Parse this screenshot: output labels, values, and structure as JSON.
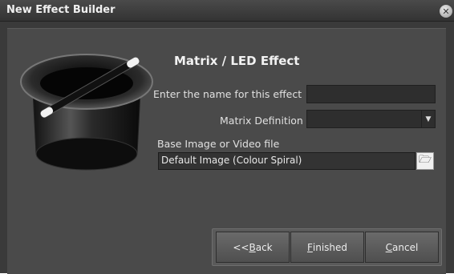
{
  "window": {
    "title": "New Effect Builder",
    "close_glyph": "✕"
  },
  "main": {
    "heading": "Matrix / LED Effect",
    "name_label": "Enter the name for this effect",
    "name_value": "",
    "matrix_label": "Matrix Definition",
    "matrix_value": "",
    "matrix_arrow": "▼",
    "base_label": "Base Image or Video file",
    "base_value": "Default Image (Colour Spiral)",
    "browse_icon": "folder-open-icon",
    "browse_glyph": "🗁"
  },
  "buttons": {
    "back_prefix": "<< ",
    "back_mnemonic": "B",
    "back_rest": "ack",
    "finished_mnemonic": "F",
    "finished_rest": "inished",
    "cancel_mnemonic": "C",
    "cancel_rest": "ancel"
  }
}
